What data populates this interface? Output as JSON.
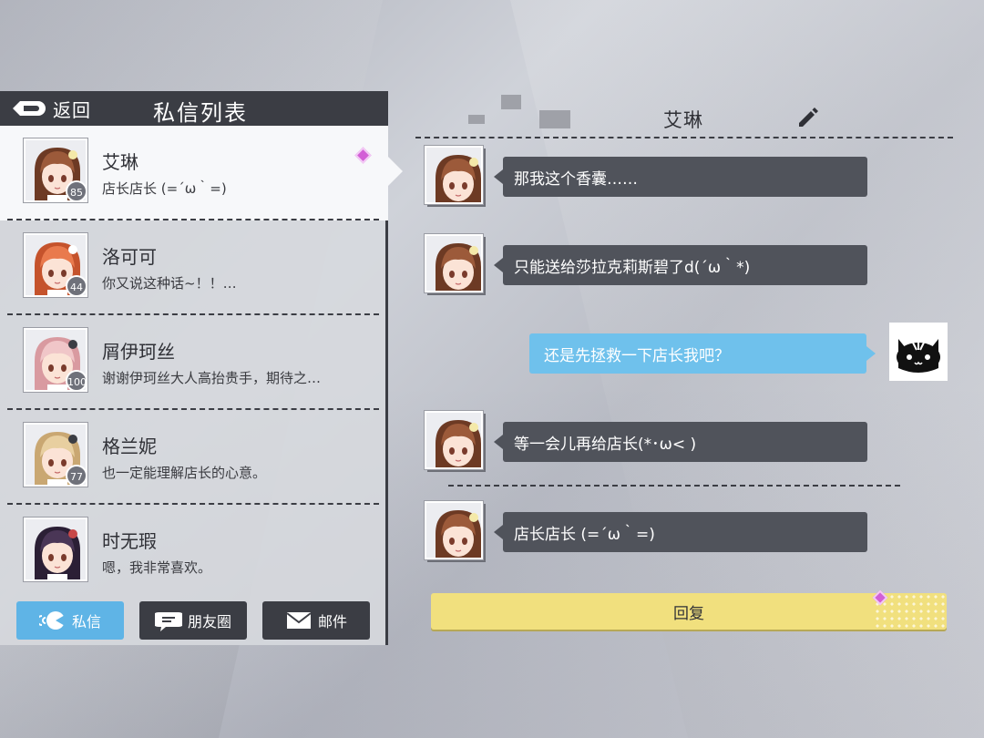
{
  "header": {
    "back_label": "返回",
    "title": "私信列表"
  },
  "contacts": [
    {
      "name": "艾琳",
      "preview": "店长店长 (=´ω｀=)",
      "level": "85",
      "active": true,
      "unread": true,
      "hair": "#9c5a3a",
      "hair_dark": "#6d3a24",
      "accent": "#f4e9a9"
    },
    {
      "name": "洛可可",
      "preview": "你又说这种话~！！…",
      "level": "44",
      "hair": "#e97a4d",
      "hair_dark": "#c5532c",
      "accent": "#ffffff"
    },
    {
      "name": "屑伊珂丝",
      "preview": "谢谢伊珂丝大人高抬贵手，期待之…",
      "level": "100",
      "hair": "#f0c6c8",
      "hair_dark": "#d99aa0",
      "accent": "#3b3d44"
    },
    {
      "name": "格兰妮",
      "preview": "也一定能理解店长的心意。",
      "level": "77",
      "hair": "#e8cfa0",
      "hair_dark": "#c9a772",
      "accent": "#3b3d44"
    },
    {
      "name": "时无瑕",
      "preview": "嗯，我非常喜欢。",
      "level": "",
      "hair": "#4a3656",
      "hair_dark": "#2b1f35",
      "accent": "#c84848"
    }
  ],
  "tabs": [
    {
      "label": "私信",
      "icon": "chat-bubble-icon",
      "active": true
    },
    {
      "label": "朋友圈",
      "icon": "moments-icon",
      "active": false
    },
    {
      "label": "邮件",
      "icon": "mail-icon",
      "active": false
    }
  ],
  "chat": {
    "title": "艾琳",
    "messages": [
      {
        "from": "them",
        "text": "那我这个香囊……"
      },
      {
        "from": "them",
        "text": "只能送给莎拉克莉斯碧了d(´ω｀*)"
      },
      {
        "from": "me",
        "text": "还是先拯救一下店长我吧？"
      },
      {
        "from": "them",
        "text": "等一会儿再给店长(*･ω< )"
      },
      {
        "from": "them",
        "text": "店长店长 (=´ω｀=)"
      }
    ],
    "reply_label": "回复"
  },
  "colors": {
    "panel_dark": "#3b3d44",
    "bubble_them": "#50535b",
    "bubble_me": "#6fc1ec",
    "reply_bg": "#f1e07e",
    "active_tab": "#5fb4e6",
    "unread": "#d25fd6"
  }
}
